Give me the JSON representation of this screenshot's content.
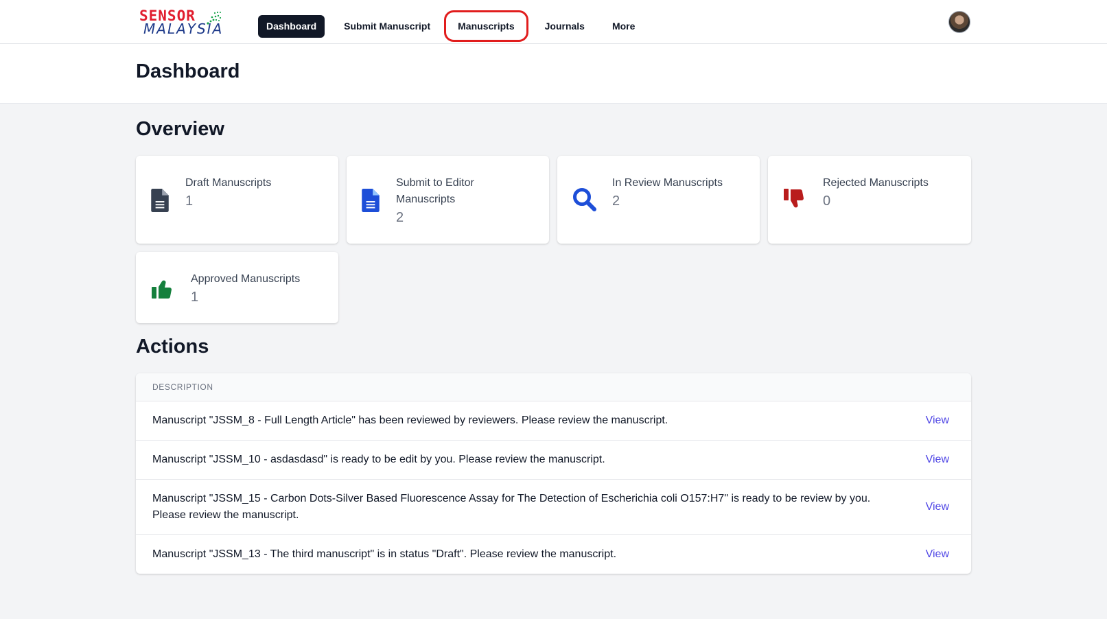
{
  "brand": {
    "logo_line1": "SENSOR",
    "logo_line2": "MALAYSIA"
  },
  "nav": {
    "items": [
      {
        "label": "Dashboard",
        "state": "active"
      },
      {
        "label": "Submit Manuscript",
        "state": "normal"
      },
      {
        "label": "Manuscripts",
        "state": "highlighted"
      },
      {
        "label": "Journals",
        "state": "normal"
      },
      {
        "label": "More",
        "state": "normal"
      }
    ]
  },
  "page": {
    "title": "Dashboard"
  },
  "overview": {
    "title": "Overview",
    "cards": [
      {
        "label": "Draft Manuscripts",
        "value": "1",
        "icon": "document-icon",
        "color": "#374151"
      },
      {
        "label": "Submit to Editor Manuscripts",
        "value": "2",
        "icon": "document-icon",
        "color": "#1d4ed8"
      },
      {
        "label": "In Review Manuscripts",
        "value": "2",
        "icon": "search-icon",
        "color": "#1d4ed8"
      },
      {
        "label": "Rejected Manuscripts",
        "value": "0",
        "icon": "thumbs-down-icon",
        "color": "#b91c1c"
      },
      {
        "label": "Approved Manuscripts",
        "value": "1",
        "icon": "thumbs-up-icon",
        "color": "#15803d"
      }
    ]
  },
  "actions": {
    "title": "Actions",
    "column_header": "DESCRIPTION",
    "rows": [
      {
        "description": "Manuscript \"JSSM_8 - Full Length Article\" has been reviewed by reviewers. Please review the manuscript.",
        "link": "View"
      },
      {
        "description": "Manuscript \"JSSM_10 - asdasdasd\" is ready to be edit by you. Please review the manuscript.",
        "link": "View"
      },
      {
        "description": "Manuscript \"JSSM_15 - Carbon Dots-Silver Based Fluorescence Assay for The Detection of Escherichia coli O157:H7\" is ready to be review by you. Please review the manuscript.",
        "link": "View"
      },
      {
        "description": "Manuscript \"JSSM_13 - The third manuscript\" is in status \"Draft\". Please review the manuscript.",
        "link": "View"
      }
    ]
  }
}
